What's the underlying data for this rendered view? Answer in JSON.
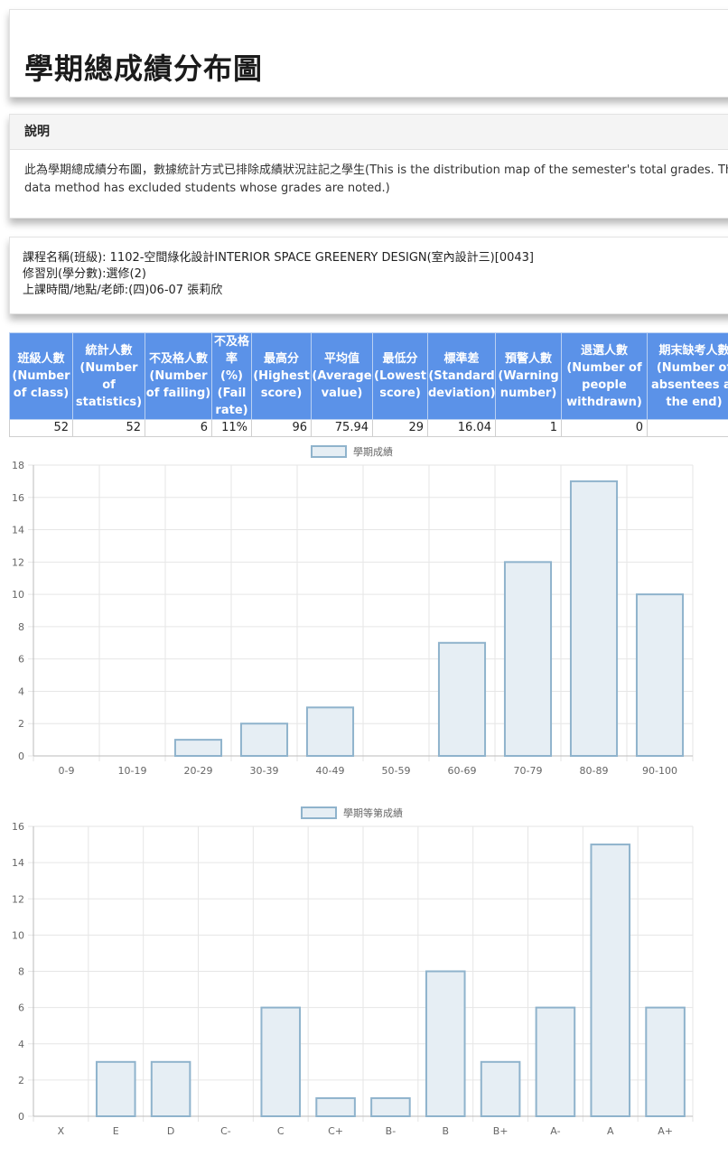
{
  "page_title": "學期總成績分布圖",
  "description": {
    "heading": "說明",
    "text": "此為學期總成績分布圖，數據統計方式已排除成績狀況註記之學生(This is the distribution map of the semester's total grades. The data method has excluded students whose grades are noted.)"
  },
  "course_info": {
    "line1": "課程名稱(班級): 1102-空間綠化設計INTERIOR SPACE GREENERY DESIGN(室內設計三)[0043]",
    "line2": "修習別(學分數):選修(2)",
    "line3": "上課時間/地點/老師:(四)06-07 張莉欣"
  },
  "stats": {
    "headers": [
      "班級人數(Number of class)",
      "統計人數(Number of statistics)",
      "不及格人數(Number of failing)",
      "不及格率(%)(Fail rate)",
      "最高分(Highest score)",
      "平均值(Average value)",
      "最低分(Lowest score)",
      "標準差(Standard deviation)",
      "預警人數(Warning number)",
      "退選人數(Number of people withdrawn)",
      "期末缺考人數(Number of absentees at the end)"
    ],
    "values": [
      "52",
      "52",
      "6",
      "11%",
      "96",
      "75.94",
      "29",
      "16.04",
      "1",
      "0",
      ""
    ]
  },
  "colors": {
    "header_blue": "#5b92e8",
    "bar_fill": "#e6eef4",
    "bar_stroke": "#8fb3cc",
    "grid": "#e6e6e6"
  },
  "chart_data": [
    {
      "type": "bar",
      "title": "",
      "legend": "學期成績",
      "legend_position": "top-center",
      "categories": [
        "0-9",
        "10-19",
        "20-29",
        "30-39",
        "40-49",
        "50-59",
        "60-69",
        "70-79",
        "80-89",
        "90-100"
      ],
      "series": [
        {
          "name": "學期成績",
          "values": [
            0,
            0,
            1,
            2,
            3,
            0,
            7,
            12,
            17,
            10
          ]
        }
      ],
      "ylim": [
        0,
        18
      ],
      "yticks": [
        0,
        2,
        4,
        6,
        8,
        10,
        12,
        14,
        16,
        18
      ],
      "grid": true
    },
    {
      "type": "bar",
      "title": "",
      "legend": "學期等第成績",
      "legend_position": "top-center",
      "categories": [
        "X",
        "E",
        "D",
        "C-",
        "C",
        "C+",
        "B-",
        "B",
        "B+",
        "A-",
        "A",
        "A+"
      ],
      "series": [
        {
          "name": "學期等第成績",
          "values": [
            0,
            3,
            3,
            0,
            6,
            1,
            1,
            8,
            3,
            6,
            15,
            6
          ]
        }
      ],
      "ylim": [
        0,
        16
      ],
      "yticks": [
        0,
        2,
        4,
        6,
        8,
        10,
        12,
        14,
        16
      ],
      "grid": true
    }
  ]
}
